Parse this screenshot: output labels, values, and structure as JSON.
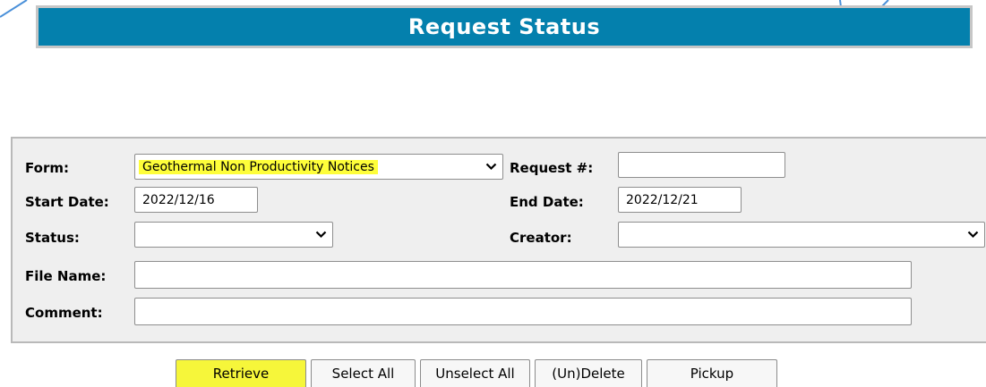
{
  "header": {
    "title": "Request Status"
  },
  "form": {
    "form_label": "Form:",
    "form_value": "Geothermal Non Productivity Notices",
    "request_label": "Request #:",
    "request_value": "",
    "start_date_label": "Start Date:",
    "start_date_value": "2022/12/16",
    "end_date_label": "End Date:",
    "end_date_value": "2022/12/21",
    "status_label": "Status:",
    "status_value": "",
    "creator_label": "Creator:",
    "creator_value": "",
    "file_name_label": "File Name:",
    "file_name_value": "",
    "comment_label": "Comment:",
    "comment_value": ""
  },
  "buttons": {
    "retrieve": "Retrieve",
    "select_all": "Select All",
    "unselect_all": "Unselect All",
    "undelete": "(Un)Delete",
    "pickup": "Pickup"
  },
  "colors": {
    "header_bg": "#0480ad",
    "highlight": "#fefe3a",
    "panel_bg": "#efefef"
  },
  "icons": [
    "chevron-down-icon"
  ]
}
